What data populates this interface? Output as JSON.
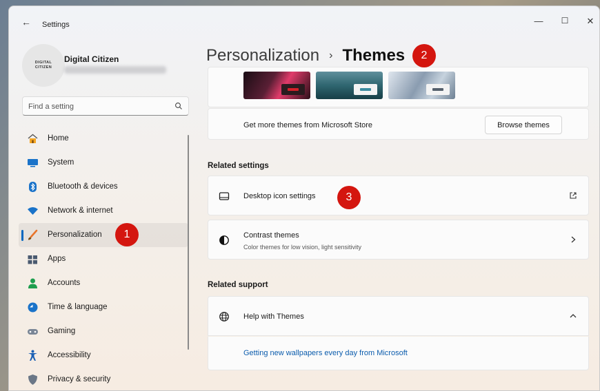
{
  "window": {
    "title": "Settings",
    "back_glyph": "←",
    "minimize_glyph": "—",
    "maximize_glyph": "☐",
    "close_glyph": "✕"
  },
  "user": {
    "name": "Digital Citizen",
    "avatar_text_line1": "DIGITAL",
    "avatar_text_line2": "CITIZEN"
  },
  "search": {
    "placeholder": "Find a setting",
    "icon": "search-icon"
  },
  "sidebar": {
    "items": [
      {
        "label": "Home",
        "icon": "home-icon",
        "active": false
      },
      {
        "label": "System",
        "icon": "system-icon",
        "active": false
      },
      {
        "label": "Bluetooth & devices",
        "icon": "bluetooth-icon",
        "active": false
      },
      {
        "label": "Network & internet",
        "icon": "network-icon",
        "active": false
      },
      {
        "label": "Personalization",
        "icon": "personalization-icon",
        "active": true
      },
      {
        "label": "Apps",
        "icon": "apps-icon",
        "active": false
      },
      {
        "label": "Accounts",
        "icon": "accounts-icon",
        "active": false
      },
      {
        "label": "Time & language",
        "icon": "time-language-icon",
        "active": false
      },
      {
        "label": "Gaming",
        "icon": "gaming-icon",
        "active": false
      },
      {
        "label": "Accessibility",
        "icon": "accessibility-icon",
        "active": false
      },
      {
        "label": "Privacy & security",
        "icon": "privacy-icon",
        "active": false
      }
    ]
  },
  "breadcrumb": {
    "parent": "Personalization",
    "separator": "›",
    "current": "Themes"
  },
  "themes_card": {
    "store_label": "Get more themes from Microsoft Store",
    "browse_button": "Browse themes"
  },
  "related_settings": {
    "heading": "Related settings",
    "items": [
      {
        "title": "Desktop icon settings",
        "subtitle": "",
        "icon": "desktop-icon",
        "action_icon": "open-external-icon"
      },
      {
        "title": "Contrast themes",
        "subtitle": "Color themes for low vision, light sensitivity",
        "icon": "contrast-icon",
        "action_icon": "chevron-right-icon"
      }
    ]
  },
  "related_support": {
    "heading": "Related support",
    "help_title": "Help with Themes",
    "help_icon": "globe-icon",
    "expand_icon": "chevron-up-icon",
    "link": "Getting new wallpapers every day from Microsoft"
  },
  "annotations": [
    "1",
    "2",
    "3"
  ],
  "colors": {
    "accent": "#0067c0",
    "badge": "#d4160f",
    "link": "#0b5cad"
  }
}
